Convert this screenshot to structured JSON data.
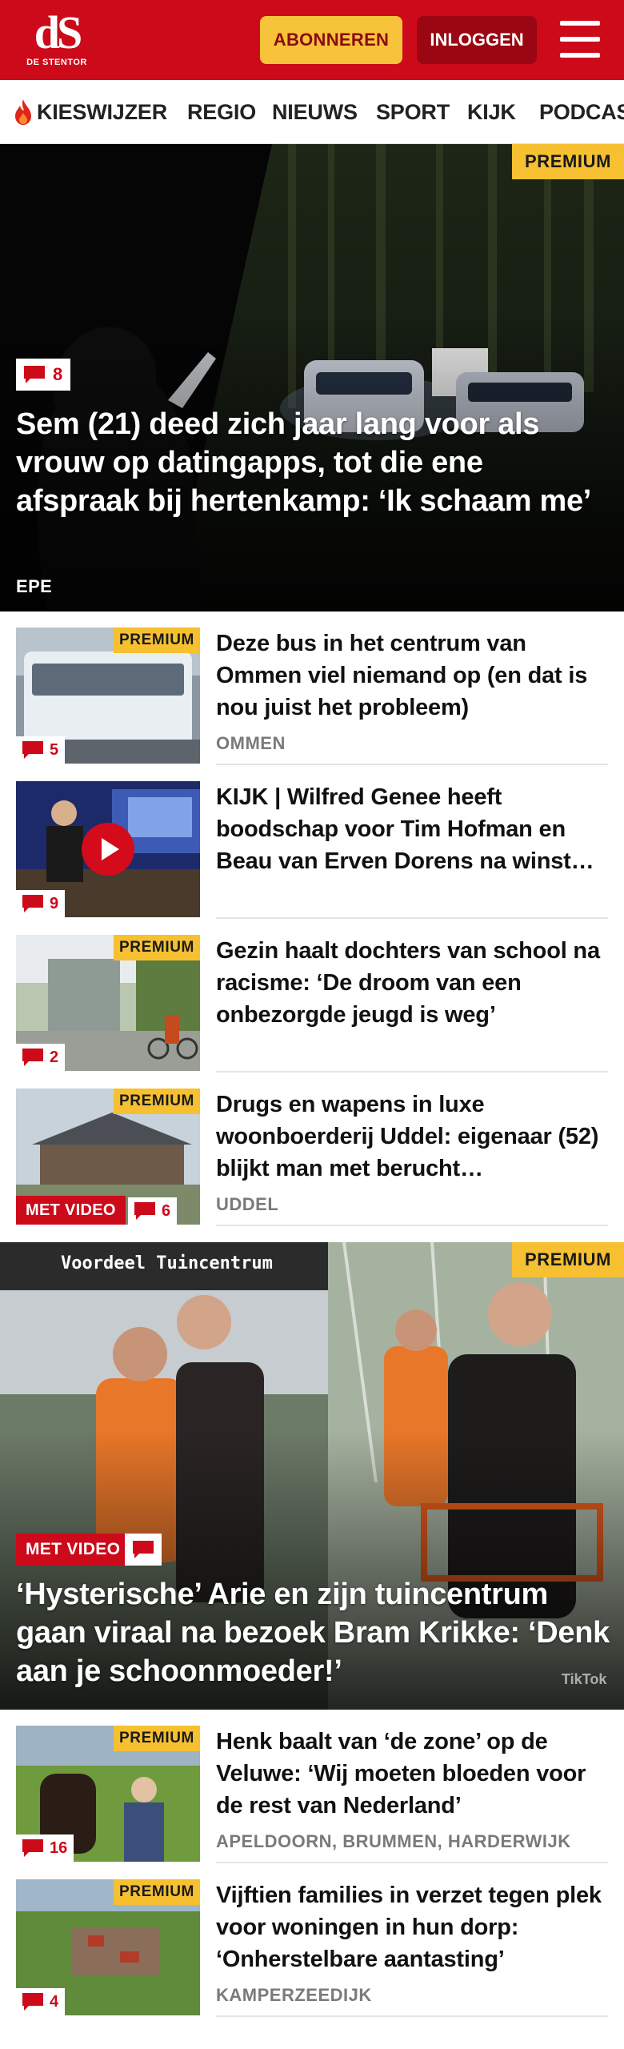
{
  "header": {
    "logo_mark": "dS",
    "logo_sub": "DE STENTOR",
    "subscribe_label": "ABONNEREN",
    "login_label": "INLOGGEN"
  },
  "nav": {
    "items": [
      "KIESWIJZER",
      "REGIO",
      "NIEUWS",
      "SPORT",
      "KIJK",
      "PODCAST"
    ]
  },
  "hero1": {
    "badge": "PREMIUM",
    "comments": "8",
    "title": "Sem (21) deed zich jaar lang voor als vrouw op datingapps, tot die ene afspraak bij hertenkamp: ‘Ik schaam me’",
    "location": "EPE"
  },
  "articles": [
    {
      "title": "Deze bus in het centrum van Ommen viel niemand op (en dat is nou juist het probleem)",
      "location": "OMMEN",
      "badge": "PREMIUM",
      "comments": "5"
    },
    {
      "title": "KIJK | Wilfred Genee heeft boodschap voor Tim Hofman en Beau van Erven Dorens na winst…",
      "location": "",
      "badge": "",
      "comments": "9"
    },
    {
      "title": "Gezin haalt dochters van school na racisme: ‘De droom van een onbezorgde jeugd is weg’",
      "location": "",
      "badge": "PREMIUM",
      "comments": "2"
    },
    {
      "title": "Drugs en wapens in luxe woonboerderij Uddel: eigenaar (52) blijkt man met berucht…",
      "location": "UDDEL",
      "badge": "PREMIUM",
      "comments": "6",
      "video_label": "MET VIDEO"
    },
    {
      "title": "Henk baalt van ‘de zone’ op de Veluwe: ‘Wij moeten bloeden voor de rest van Nederland’",
      "location": "APELDOORN, BRUMMEN, HARDERWIJK",
      "badge": "PREMIUM",
      "comments": "16"
    },
    {
      "title": "Vijftien families in verzet tegen plek voor woningen in hun dorp: ‘Onherstelbare aantasting’",
      "location": "KAMPERZEEDIJK",
      "badge": "PREMIUM",
      "comments": "4"
    }
  ],
  "hero2": {
    "badge": "PREMIUM",
    "video_label": "MET VIDEO",
    "sign_text": "Voordeel Tuincentrum",
    "watermark": "TikTok",
    "title": "‘Hysterische’ Arie en zijn tuincentrum gaan viraal na bezoek Bram Krikke: ‘Denk aan je schoonmoeder!’"
  },
  "colors": {
    "brand_red": "#cc0a1a",
    "dark_red": "#9a0612",
    "premium_yellow": "#f6c031",
    "location_gray": "#7a7a7a"
  }
}
